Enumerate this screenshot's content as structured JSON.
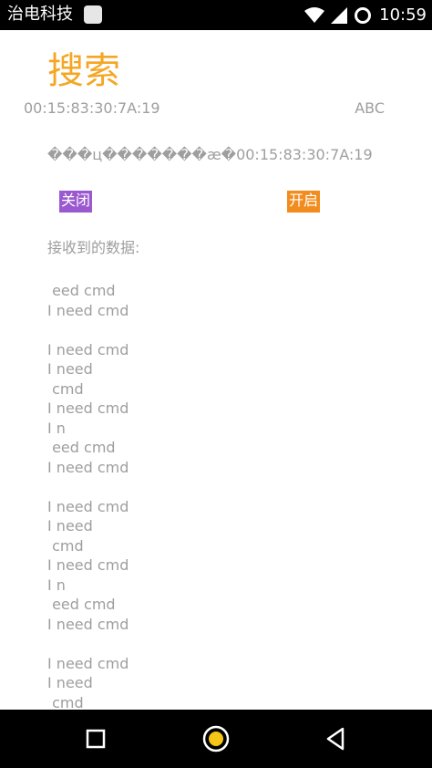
{
  "status_bar": {
    "app_name": "治电科技",
    "time": "10:59",
    "icons": [
      "app-notification-icon",
      "wifi-icon",
      "signal-icon",
      "sync-icon"
    ]
  },
  "main": {
    "title": "搜索",
    "device_mac": "00:15:83:30:7A:19",
    "device_name": "ABC",
    "garbled_line": "���ц�������æ�00:15:83:30:7A:19",
    "close_button": "关闭",
    "open_button": "开启",
    "received_label": "接收到的数据:",
    "received_log": [
      " eed cmd",
      "I need cmd",
      "",
      "I need cmd",
      "I need",
      " cmd",
      "I need cmd",
      "I n",
      " eed cmd",
      "I need cmd",
      "",
      "I need cmd",
      "I need",
      " cmd",
      "I need cmd",
      "I n",
      " eed cmd",
      "I need cmd",
      "",
      "I need cmd",
      "I need",
      " cmd"
    ]
  },
  "nav_bar": {
    "buttons": [
      "recent-apps-icon",
      "home-icon",
      "back-icon"
    ]
  },
  "colors": {
    "title": "#f5a623",
    "text_gray": "#9e9e9e",
    "close_button_bg": "#9b59d0",
    "open_button_bg": "#f28c1e",
    "home_dot": "#f5c518"
  }
}
